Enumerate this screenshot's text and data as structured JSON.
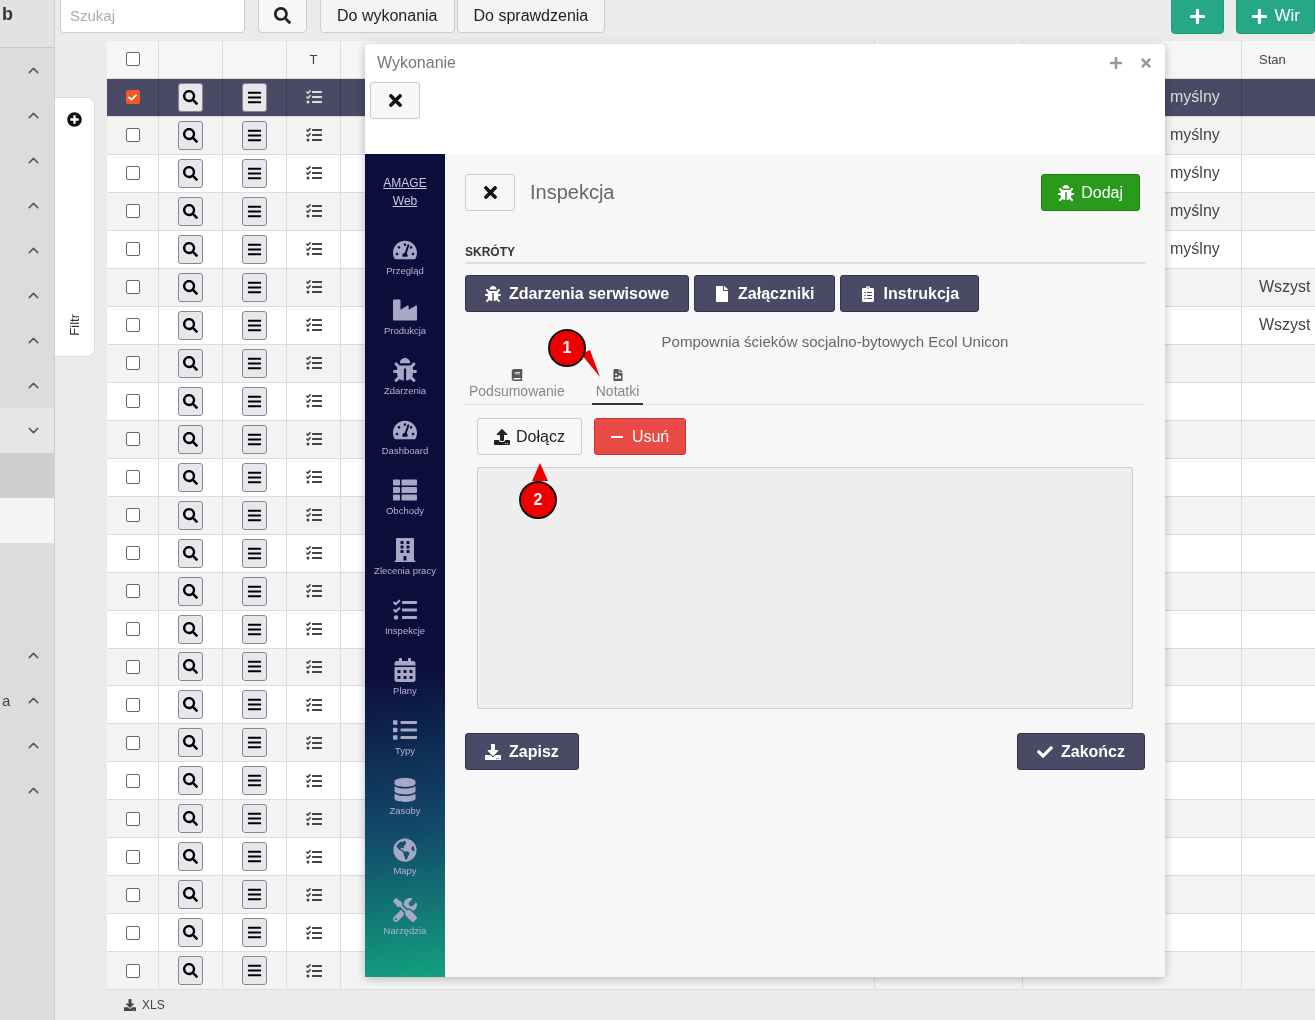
{
  "sidebar": {
    "title": "b",
    "items": [
      {
        "kind": "toggle",
        "expanded": false
      },
      {
        "kind": "toggle",
        "expanded": false
      },
      {
        "kind": "toggle",
        "expanded": false
      },
      {
        "kind": "toggle",
        "expanded": false
      },
      {
        "kind": "toggle",
        "expanded": false
      },
      {
        "kind": "toggle",
        "expanded": false
      },
      {
        "kind": "toggle",
        "expanded": false
      },
      {
        "kind": "toggle",
        "expanded": false
      },
      {
        "kind": "toggle",
        "expanded": true
      },
      {
        "kind": "band"
      },
      {
        "kind": "highlight"
      },
      {
        "kind": "spacer"
      },
      {
        "kind": "spacer"
      },
      {
        "kind": "toggle",
        "expanded": false
      },
      {
        "kind": "toggle",
        "expanded": false,
        "label": "a"
      },
      {
        "kind": "toggle",
        "expanded": false
      },
      {
        "kind": "toggle",
        "expanded": false
      }
    ]
  },
  "toolbar": {
    "search": {
      "placeholder": "Szukaj"
    },
    "filters": [
      {
        "label": "Do wykonania",
        "selected": false
      },
      {
        "label": "Do sprawdzenia",
        "selected": false
      }
    ],
    "create_label": "Wir"
  },
  "filter_tab": {
    "label": "Filtr"
  },
  "table": {
    "header": {
      "all_checked": false,
      "type_label": "T",
      "state_label": "Stan"
    },
    "rows": [
      {
        "checked": true,
        "selected": true,
        "column_7": "myślny"
      },
      {
        "checked": false,
        "selected": false,
        "column_7": "myślny"
      },
      {
        "checked": false,
        "selected": false,
        "column_7": "myślny"
      },
      {
        "checked": false,
        "selected": false,
        "column_7": "myślny"
      },
      {
        "checked": false,
        "selected": false,
        "column_7": "myślny"
      },
      {
        "checked": false,
        "selected": false,
        "stan": "Wszyst"
      },
      {
        "checked": false,
        "selected": false,
        "stan": "Wszyst"
      },
      {
        "checked": false,
        "selected": false
      },
      {
        "checked": false,
        "selected": false
      },
      {
        "checked": false,
        "selected": false
      },
      {
        "checked": false,
        "selected": false
      },
      {
        "checked": false,
        "selected": false
      },
      {
        "checked": false,
        "selected": false
      },
      {
        "checked": false,
        "selected": false
      },
      {
        "checked": false,
        "selected": false
      },
      {
        "checked": false,
        "selected": false
      },
      {
        "checked": false,
        "selected": false
      },
      {
        "checked": false,
        "selected": false
      },
      {
        "checked": false,
        "selected": false
      },
      {
        "checked": false,
        "selected": false
      },
      {
        "checked": false,
        "selected": false
      },
      {
        "checked": false,
        "selected": false
      },
      {
        "checked": false,
        "selected": false
      },
      {
        "checked": false,
        "selected": false
      }
    ]
  },
  "export": {
    "label": "XLS"
  },
  "dialog": {
    "title": "Wykonanie",
    "nav": {
      "brand": "AMAGE Web",
      "items": [
        {
          "label": "Przegląd"
        },
        {
          "label": "Produkcja"
        },
        {
          "label": "Zdarzenia"
        },
        {
          "label": "Dashboard"
        },
        {
          "label": "Obchody"
        },
        {
          "label": "Zlecenia pracy"
        },
        {
          "label": "Inspekcje"
        },
        {
          "label": "Plany"
        },
        {
          "label": "Typy"
        },
        {
          "label": "Zasoby"
        },
        {
          "label": "Mapy"
        },
        {
          "label": "Narzędzia"
        }
      ]
    },
    "header": {
      "title": "Inspekcja",
      "add_label": "Dodaj"
    },
    "shortcuts": {
      "title": "SKRÓTY",
      "buttons": [
        "Zdarzenia serwisowe",
        "Załączniki",
        "Instrukcja"
      ]
    },
    "subtitle": "Pompownia ścieków socjalno-bytowych Ecol Unicon",
    "tabs": [
      {
        "label": "Podsumowanie",
        "selected": false
      },
      {
        "label": "Notatki",
        "selected": true
      }
    ],
    "attach_label": "Dołącz",
    "remove_label": "Usuń",
    "save_label": "Zapisz",
    "finish_label": "Zakończ"
  },
  "annotations": [
    {
      "label": "1"
    },
    {
      "label": "2"
    }
  ]
}
